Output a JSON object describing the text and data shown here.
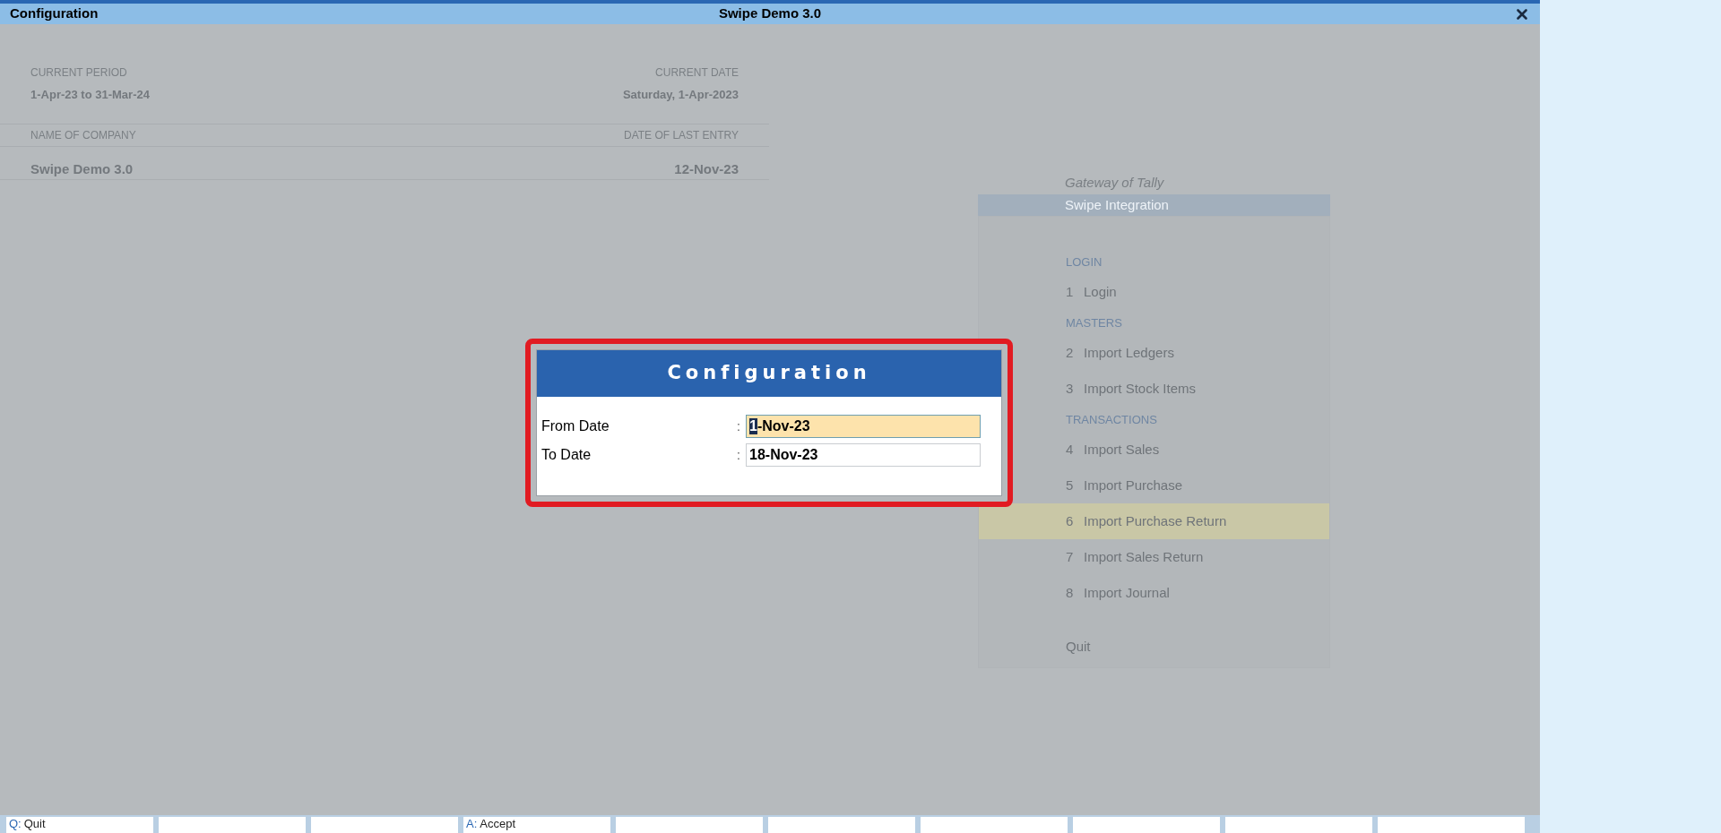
{
  "window": {
    "title": "Configuration",
    "company": "Swipe Demo 3.0"
  },
  "info": [
    {
      "label": "CURRENT PERIOD",
      "value": "1-Apr-23 to 31-Mar-24"
    },
    {
      "label": "CURRENT DATE",
      "value": "Saturday, 1-Apr-2023"
    },
    {
      "label": "NAME OF COMPANY",
      "value": "Swipe Demo 3.0"
    },
    {
      "label": "DATE OF LAST ENTRY",
      "value": "12-Nov-23"
    }
  ],
  "gateway": {
    "title": "Gateway of Tally",
    "subtitle": "Swipe Integration",
    "items": [
      {
        "kind": "heading",
        "label": "LOGIN"
      },
      {
        "kind": "item",
        "key": "1",
        "label": "Login",
        "selected": false
      },
      {
        "kind": "heading",
        "label": "MASTERS"
      },
      {
        "kind": "item",
        "key": "2",
        "label": "Import Ledgers",
        "selected": false
      },
      {
        "kind": "item",
        "key": "3",
        "label": "Import Stock Items",
        "selected": false
      },
      {
        "kind": "heading",
        "label": "TRANSACTIONS"
      },
      {
        "kind": "item",
        "key": "4",
        "label": "Import Sales",
        "selected": false
      },
      {
        "kind": "item",
        "key": "5",
        "label": "Import Purchase",
        "selected": false
      },
      {
        "kind": "item",
        "key": "6",
        "label": "Import Purchase Return",
        "selected": true
      },
      {
        "kind": "item",
        "key": "7",
        "label": "Import Sales Return",
        "selected": false
      },
      {
        "kind": "item",
        "key": "8",
        "label": "Import Journal",
        "selected": false
      },
      {
        "kind": "exit",
        "label": "Quit",
        "selected": false
      }
    ]
  },
  "dialog": {
    "title": "Configuration",
    "fields": [
      {
        "label": "From Date",
        "separator": ":",
        "value": "1-Nov-23",
        "focused": true
      },
      {
        "label": "To Date",
        "separator": ":",
        "value": "18-Nov-23",
        "focused": false
      }
    ]
  },
  "buttons": [
    {
      "kind": "key",
      "key": "Q:",
      "label": "Quit"
    },
    {
      "kind": "blank"
    },
    {
      "kind": "blank"
    },
    {
      "kind": "key",
      "key": "A:",
      "label": "Accept"
    },
    {
      "kind": "blank"
    },
    {
      "kind": "blank"
    },
    {
      "kind": "blank"
    },
    {
      "kind": "blank"
    },
    {
      "kind": "blank"
    },
    {
      "kind": "blank"
    }
  ]
}
